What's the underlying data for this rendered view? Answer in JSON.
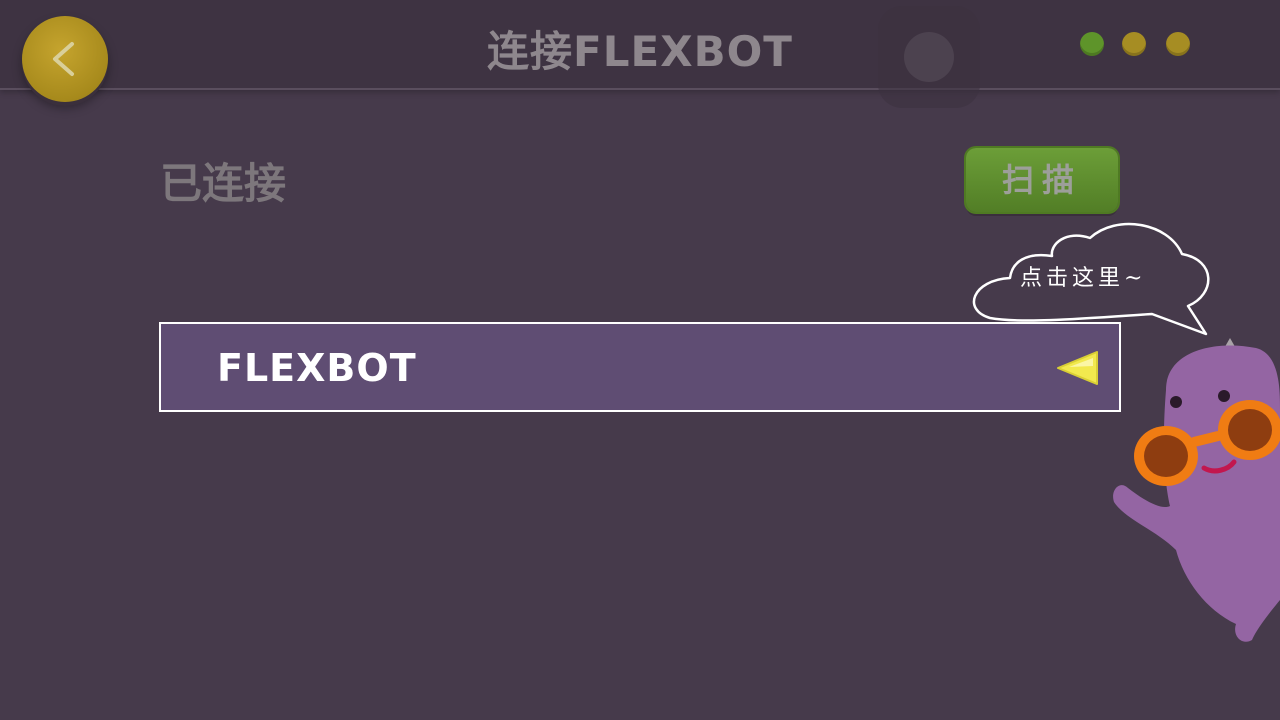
{
  "header": {
    "title": "连接FLEXBOT",
    "back_icon": "chevron-left-icon",
    "status_dots": [
      "#5e942a",
      "#a68d23",
      "#a68d23"
    ]
  },
  "main": {
    "section_title": "已连接",
    "scan_button_label": "扫描",
    "device": {
      "name": "FLEXBOT",
      "indicator_icon": "triangle-left-icon"
    }
  },
  "hint": {
    "bubble_text": "点击这里~"
  },
  "colors": {
    "background": "#463a4b",
    "device_row": "#5f4d73",
    "scan_button": "#5e942a",
    "back_button": "#a78a1c",
    "indicator": "#f2e94e"
  }
}
